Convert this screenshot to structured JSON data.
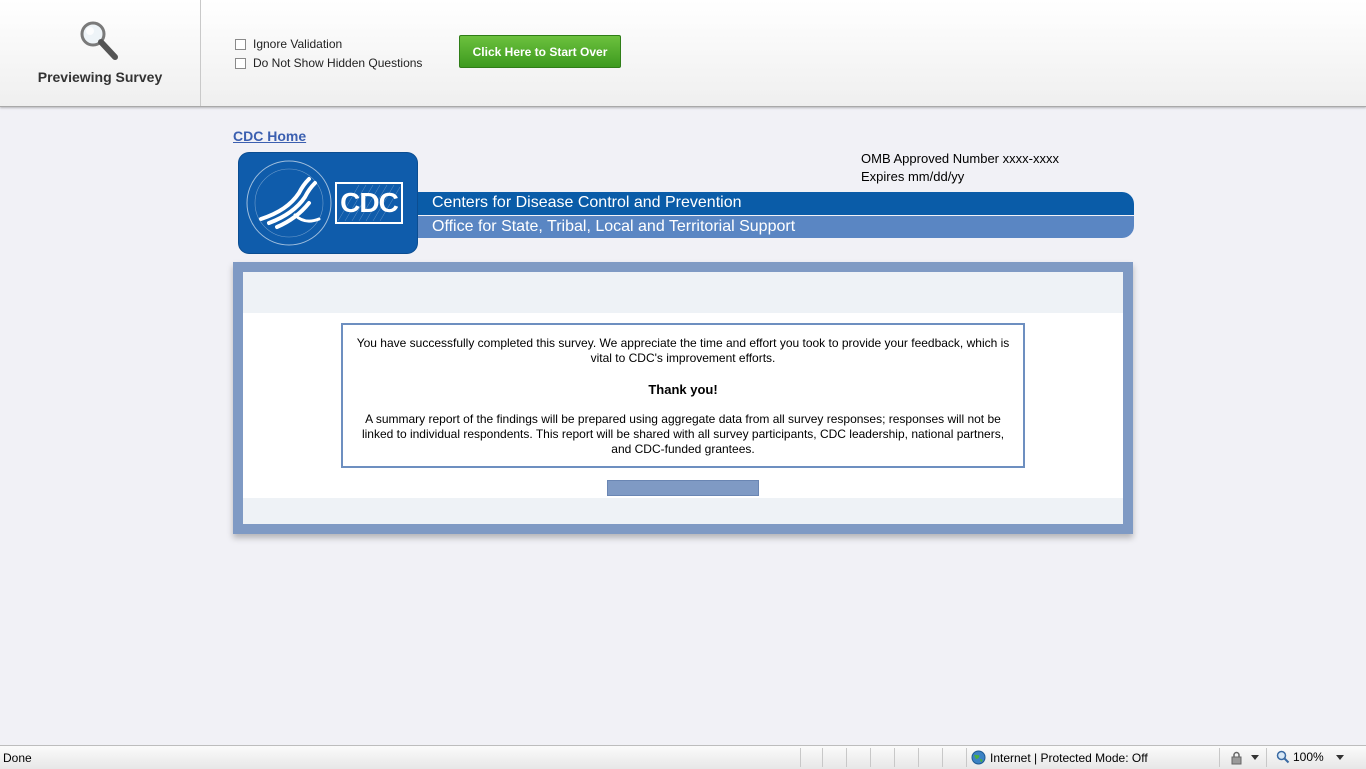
{
  "preview": {
    "title": "Previewing Survey",
    "options": [
      {
        "label": "Ignore Validation",
        "checked": false
      },
      {
        "label": "Do Not Show Hidden Questions",
        "checked": false
      }
    ],
    "start_over_label": "Click Here to Start Over"
  },
  "header": {
    "home_link": "CDC Home",
    "omb_line1": "OMB Approved Number xxxx-xxxx",
    "omb_line2": "Expires mm/dd/yy",
    "banner_line1": "Centers for Disease Control and Prevention",
    "banner_line2": "Office for State, Tribal, Local and Territorial Support",
    "logo_text": "CDC"
  },
  "content": {
    "paragraph1": "You have successfully completed this survey.  We appreciate the time and effort you took to provide your feedback, which is vital to CDC's improvement efforts.",
    "thanks": "Thank you!",
    "paragraph2": "A summary report of the findings will be prepared using aggregate data from all survey responses; responses will not be linked to individual respondents.  This report will be shared with all survey participants, CDC leadership, national partners, and CDC-funded grantees."
  },
  "statusbar": {
    "status": "Done",
    "zone": "Internet | Protected Mode: Off",
    "zoom": "100%"
  },
  "colors": {
    "accent_green": "#4aa828",
    "cdc_blue": "#0a5ca8",
    "banner_light_blue": "#5a86c3",
    "card_border": "#7f9ac4"
  },
  "icons": {
    "preview": "magnifier-icon",
    "zone": "globe-icon",
    "zoom": "zoom-icon",
    "security": "lock-icon"
  }
}
